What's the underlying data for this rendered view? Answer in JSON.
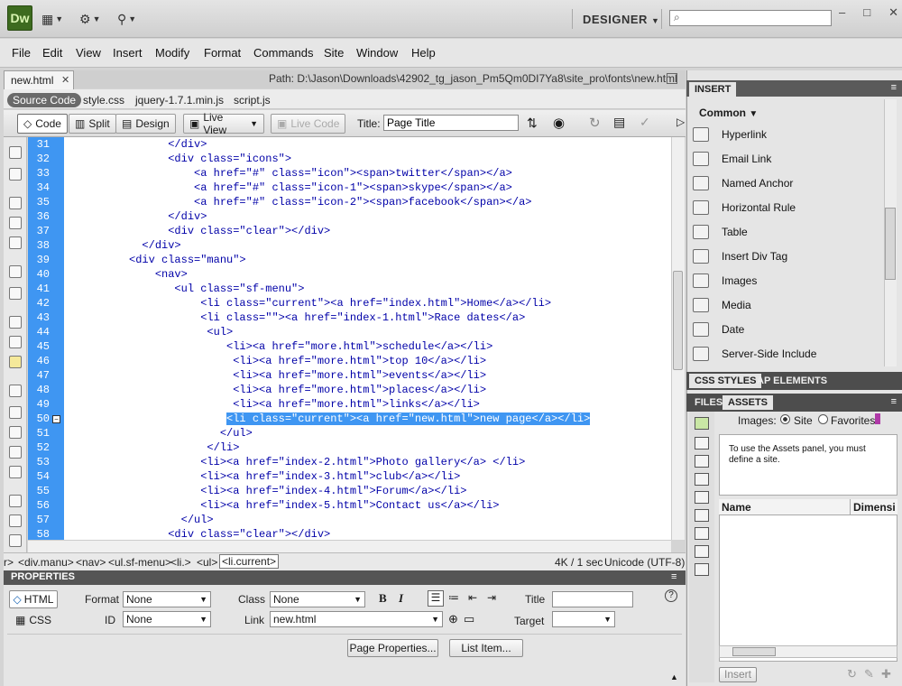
{
  "app": {
    "logo": "Dw",
    "workspace": "DESIGNER",
    "search_placeholder": ""
  },
  "window_controls": {
    "minimize": "–",
    "maximize": "□",
    "close": "✕"
  },
  "menu": [
    "File",
    "Edit",
    "View",
    "Insert",
    "Modify",
    "Format",
    "Commands",
    "Site",
    "Window",
    "Help"
  ],
  "document": {
    "tab": "new.html",
    "tab_close": "✕",
    "path": "Path:  D:\\Jason\\Downloads\\42902_tg_jason_Pm5Qm0DI7Ya8\\site_pro\\fonts\\new.html",
    "related_files": [
      "Source Code",
      "style.css",
      "jquery-1.7.1.min.js",
      "script.js"
    ]
  },
  "toolbar": {
    "code": "Code",
    "split": "Split",
    "design": "Design",
    "live_view": "Live View",
    "live_code": "Live Code",
    "title_label": "Title:",
    "title_value": "Page Title"
  },
  "code_lines": [
    {
      "n": "31",
      "t": "                </div>"
    },
    {
      "n": "32",
      "t": "                <div class=\"icons\">"
    },
    {
      "n": "33",
      "t": "                    <a href=\"#\" class=\"icon\"><span>twitter</span></a>"
    },
    {
      "n": "34",
      "t": "                    <a href=\"#\" class=\"icon-1\"><span>skype</span></a>"
    },
    {
      "n": "35",
      "t": "                    <a href=\"#\" class=\"icon-2\"><span>facebook</span></a>"
    },
    {
      "n": "36",
      "t": "                </div>"
    },
    {
      "n": "37",
      "t": "                <div class=\"clear\"></div>"
    },
    {
      "n": "38",
      "t": "            </div>"
    },
    {
      "n": "39",
      "t": "          <div class=\"manu\">"
    },
    {
      "n": "40",
      "t": "              <nav>"
    },
    {
      "n": "41",
      "t": "                 <ul class=\"sf-menu\">"
    },
    {
      "n": "42",
      "t": "                     <li class=\"current\"><a href=\"index.html\">Home</a></li>"
    },
    {
      "n": "43",
      "t": "                     <li class=\"\"><a href=\"index-1.html\">Race dates</a>"
    },
    {
      "n": "44",
      "t": "                      <ul>"
    },
    {
      "n": "45",
      "t": "                         <li><a href=\"more.html\">schedule</a></li>"
    },
    {
      "n": "46",
      "t": "                          <li><a href=\"more.html\">top 10</a></li>"
    },
    {
      "n": "47",
      "t": "                          <li><a href=\"more.html\">events</a></li>"
    },
    {
      "n": "48",
      "t": "                          <li><a href=\"more.html\">places</a></li>"
    },
    {
      "n": "49",
      "t": "                          <li><a href=\"more.html\">links</a></li>"
    },
    {
      "n": "50",
      "t": "                         <li class=\"current\"><a href=\"new.html\">new page</a></li>"
    },
    {
      "n": "51",
      "t": "                        </ul>"
    },
    {
      "n": "52",
      "t": "                      </li>"
    },
    {
      "n": "53",
      "t": "                     <li><a href=\"index-2.html\">Photo gallery</a> </li>"
    },
    {
      "n": "54",
      "t": "                     <li><a href=\"index-3.html\">club</a></li>"
    },
    {
      "n": "55",
      "t": "                     <li><a href=\"index-4.html\">Forum</a></li>"
    },
    {
      "n": "56",
      "t": "                     <li><a href=\"index-5.html\">Contact us</a></li>"
    },
    {
      "n": "57",
      "t": "                  </ul>"
    },
    {
      "n": "58",
      "t": "                <div class=\"clear\"></div>"
    }
  ],
  "selected_line": "50",
  "status": {
    "crumbs": [
      "r>",
      "<div.manu>",
      "<nav>",
      "<ul.sf-menu>",
      "<li.>",
      "<ul>",
      "<li.current>"
    ],
    "size": "4K / 1 sec",
    "encoding": "Unicode (UTF-8)"
  },
  "properties": {
    "title": "PROPERTIES",
    "html_btn": "HTML",
    "css_btn": "CSS",
    "format_label": "Format",
    "format_value": "None",
    "id_label": "ID",
    "id_value": "None",
    "class_label": "Class",
    "class_value": "None",
    "link_label": "Link",
    "link_value": "new.html",
    "title_label": "Title",
    "target_label": "Target",
    "bold": "B",
    "italic": "I",
    "page_properties": "Page Properties...",
    "list_item": "List Item...",
    "help": "?"
  },
  "insert_panel": {
    "title": "INSERT",
    "category": "Common",
    "items": [
      "Hyperlink",
      "Email Link",
      "Named Anchor",
      "Horizontal Rule",
      "Table",
      "Insert Div Tag",
      "Images",
      "Media",
      "Date",
      "Server-Side Include"
    ]
  },
  "css_panel": {
    "tab1": "CSS STYLES",
    "tab2": "AP ELEMENTS"
  },
  "assets_panel": {
    "tab_files": "FILES",
    "tab_assets": "ASSETS",
    "images_label": "Images:",
    "site_label": "Site",
    "favorites_label": "Favorites",
    "message": "To use the Assets panel, you must define a site.",
    "col_name": "Name",
    "col_dim": "Dimensi",
    "insert_btn": "Insert"
  }
}
